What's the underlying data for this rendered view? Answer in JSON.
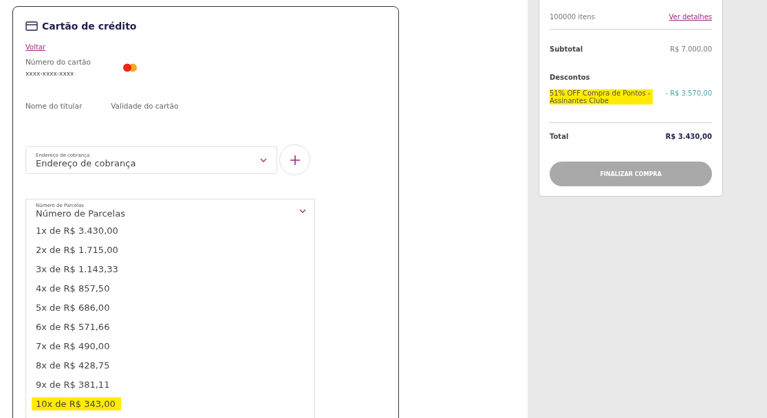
{
  "payment": {
    "title": "Cartão de crédito",
    "back_link": "Voltar",
    "card_number": {
      "label": "Número do cartão",
      "value": "xxxx-xxxx-xxxx"
    },
    "holder_name": {
      "label": "Nome do titular"
    },
    "expiry": {
      "label": "Validade do cartão"
    },
    "billing_address": {
      "floating_label": "Endereço de cobrança",
      "value": "Endereço de cobrança"
    },
    "installments": {
      "floating_label": "Número de Parcelas",
      "value": "Número de Parcelas",
      "options": [
        {
          "label": "1x de R$ 3.430,00",
          "highlighted": false
        },
        {
          "label": "2x de R$ 1.715,00",
          "highlighted": false
        },
        {
          "label": "3x de R$ 1.143,33",
          "highlighted": false
        },
        {
          "label": "4x de R$ 857,50",
          "highlighted": false
        },
        {
          "label": "5x de R$ 686,00",
          "highlighted": false
        },
        {
          "label": "6x de R$ 571,66",
          "highlighted": false
        },
        {
          "label": "7x de R$ 490,00",
          "highlighted": false
        },
        {
          "label": "8x de R$ 428,75",
          "highlighted": false
        },
        {
          "label": "9x de R$ 381,11",
          "highlighted": false
        },
        {
          "label": "10x de R$ 343,00",
          "highlighted": true
        }
      ]
    }
  },
  "summary": {
    "items_count": "100000 itens",
    "details_link": "Ver detalhes",
    "subtotal": {
      "label": "Subtotal",
      "value": "R$ 7.000,00"
    },
    "discounts": {
      "label": "Descontos",
      "items": [
        {
          "label": "51% OFF Compra de Pontos - Assinantes Clube",
          "value": "- R$ 3.570,00",
          "highlighted": true
        }
      ]
    },
    "total": {
      "label": "Total",
      "value": "R$ 3.430,00"
    },
    "checkout_button": {
      "label": "FINALIZAR COMPRA",
      "disabled": true
    }
  }
}
